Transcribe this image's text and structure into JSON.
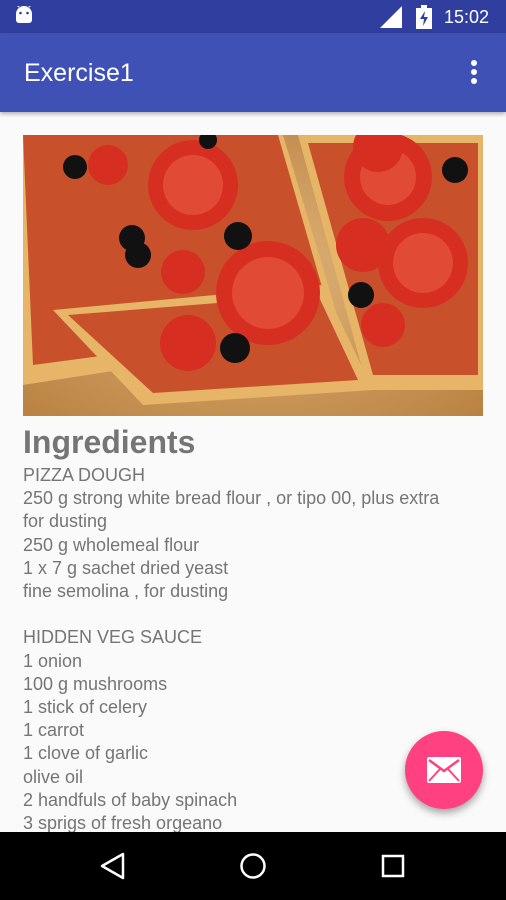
{
  "status_bar": {
    "time": "15:02",
    "icons": [
      "android-icon",
      "signal-icon",
      "battery-charging-icon"
    ]
  },
  "app_bar": {
    "title": "Exercise1",
    "menu_icon": "more-vert-icon"
  },
  "content": {
    "heading": "Ingredients",
    "lines": [
      "PIZZA DOUGH",
      "250 g strong white bread flour , or tipo 00, plus extra",
      "for dusting",
      "250 g wholemeal flour",
      "1 x 7 g sachet dried yeast",
      "fine semolina , for dusting",
      "",
      "HIDDEN VEG SAUCE",
      "1 onion",
      "100 g mushrooms",
      "1 stick of celery",
      "1 carrot",
      "1 clove of garlic",
      "olive oil",
      "2 handfuls of baby spinach",
      "3 sprigs of fresh orgeano"
    ]
  },
  "fab": {
    "icon": "email-icon"
  },
  "nav_bar": {
    "icons": [
      "back-icon",
      "home-icon",
      "recents-icon"
    ]
  },
  "colors": {
    "status_bar": "#303f9f",
    "app_bar": "#3f51b5",
    "accent": "#ff4081",
    "text": "#757575",
    "background": "#fafafa"
  }
}
